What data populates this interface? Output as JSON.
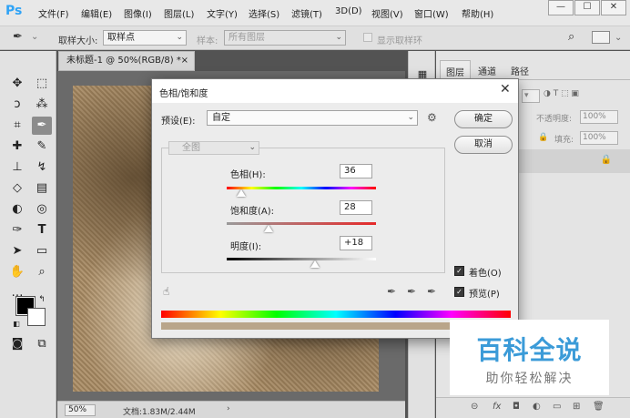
{
  "app": {
    "logo": "Ps"
  },
  "menu": [
    "文件(F)",
    "编辑(E)",
    "图像(I)",
    "图层(L)",
    "文字(Y)",
    "选择(S)",
    "滤镜(T)",
    "3D(D)",
    "视图(V)",
    "窗口(W)",
    "帮助(H)"
  ],
  "window_controls": {
    "minimize": "—",
    "maximize": "☐",
    "close": "✕"
  },
  "options_bar": {
    "sample_size_label": "取样大小:",
    "sample_size_value": "取样点",
    "sample_label": "样本:",
    "sample_value": "所有图层",
    "show_ring_label": "显示取样环"
  },
  "document": {
    "tab_title": "未标题-1 @ 50%(RGB/8) *",
    "tab_close": "×",
    "zoom": "50%",
    "doc_info": "文档:1.83M/2.44M",
    "status_arrow": "›"
  },
  "panels": {
    "tabs": [
      "图层",
      "通道",
      "路径"
    ],
    "opacity_label": "不透明度:",
    "opacity_value": "100%",
    "fill_label": "填充:",
    "fill_value": "100%",
    "lock_symbol": "🔒"
  },
  "dialog": {
    "title": "色相/饱和度",
    "close": "✕",
    "preset_label": "预设(E):",
    "preset_value": "自定",
    "ok_label": "确定",
    "cancel_label": "取消",
    "channel_value": "全图",
    "hue_label": "色相(H):",
    "hue_value": "36",
    "saturation_label": "饱和度(A):",
    "saturation_value": "28",
    "lightness_label": "明度(I):",
    "lightness_value": "+18",
    "colorize_label": "着色(O)",
    "colorize_checked": true,
    "preview_label": "预览(P)",
    "preview_checked": true,
    "hue_level": 0.1,
    "saturation_level": 0.28,
    "lightness_level": 0.59
  },
  "watermark": {
    "title": "百科全说",
    "subtitle": "助你轻松解决"
  },
  "colors": {
    "accent": "#2fa3f6",
    "watermark_blue": "#3b9bd8"
  }
}
